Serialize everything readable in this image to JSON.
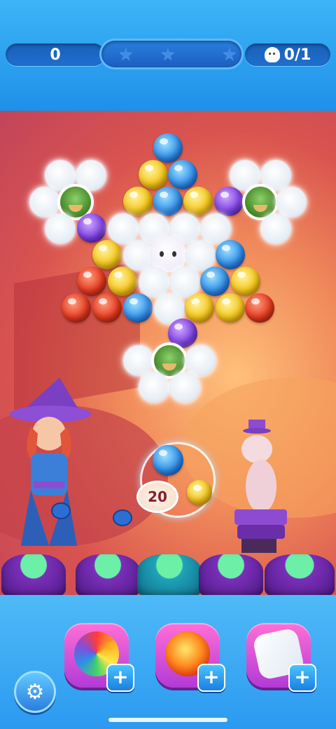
{
  "hud": {
    "score": "0",
    "stars_earned": 0,
    "goal_icon": "ghost-icon",
    "goal_progress": "0/1"
  },
  "board": {
    "moves_left": "20",
    "bubble_colors": {
      "blue": "#2f8de8",
      "yellow": "#f5c518",
      "red": "#e43a1f",
      "purple": "#7b3fe0"
    }
  },
  "boosters": [
    {
      "name": "rainbow-bubble-icon",
      "add_label": "+"
    },
    {
      "name": "fireball-icon",
      "add_label": "+"
    },
    {
      "name": "wand-bubble-icon",
      "add_label": "+"
    }
  ],
  "settings_icon": "gear-icon"
}
